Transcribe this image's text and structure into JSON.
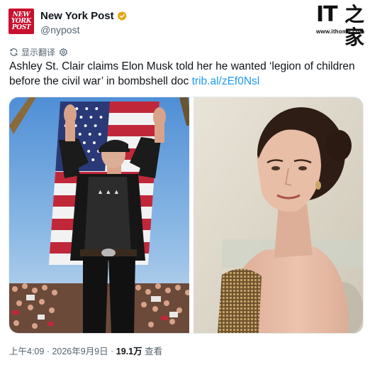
{
  "author": {
    "display_name": "New York Post",
    "handle": "@nypost",
    "logo_text": [
      "NEW",
      "YORK",
      "POST"
    ]
  },
  "watermark": {
    "logo_it": "IT",
    "logo_zh": "之家",
    "url": "www.ithome.com"
  },
  "translate": {
    "label": "显示翻译"
  },
  "tweet": {
    "text": "Ashley St. Clair claims Elon Musk told her he wanted ‘legion of children before the civil war’ in bombshell doc ",
    "link": "trib.al/zEf0Nsl"
  },
  "footer": {
    "time": "上午4:09",
    "sep1": " · ",
    "date": "2026年9月9日",
    "sep2": " · ",
    "views_count": "19.1万",
    "views_label": " 查看"
  },
  "colors": {
    "brand_red": "#c8102e",
    "link_blue": "#1d9bf0",
    "verified_gold": "#e2a616",
    "secondary_text": "#536471"
  },
  "icons": {
    "verified": "verified-badge-icon",
    "translate": "translate-icon",
    "settings": "gear-icon"
  }
}
